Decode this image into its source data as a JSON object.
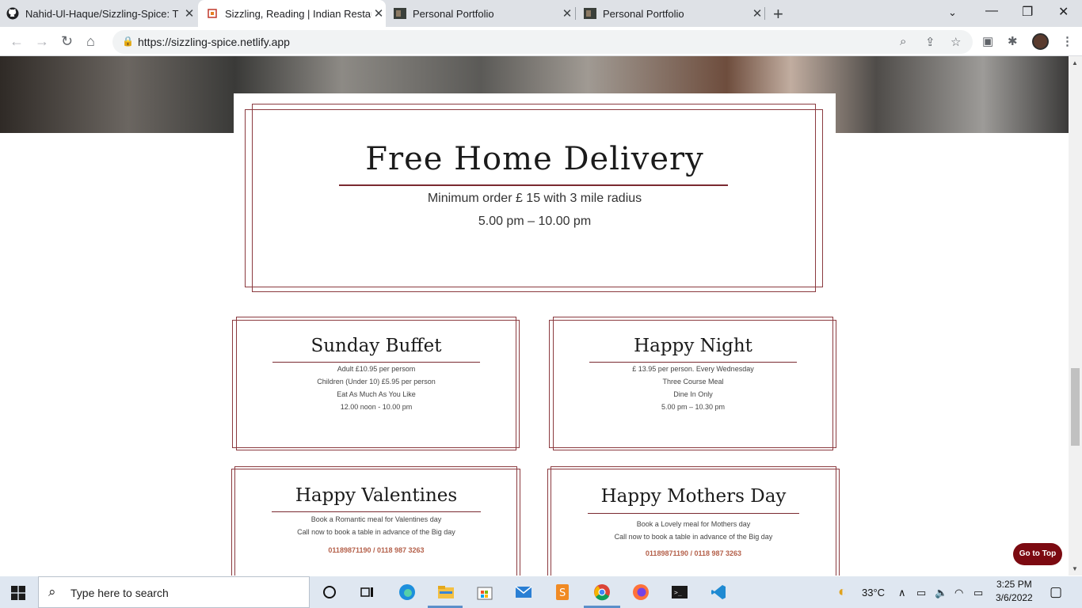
{
  "tabs": [
    {
      "title": "Nahid-Ul-Haque/Sizzling-Spice: T",
      "icon": "github-icon"
    },
    {
      "title": "Sizzling, Reading | Indian Restaur",
      "icon": "restaurant-logo-icon"
    },
    {
      "title": "Personal Portfolio",
      "icon": "portfolio-thumbnail-icon"
    },
    {
      "title": "Personal Portfolio",
      "icon": "portfolio-thumbnail-icon"
    }
  ],
  "address_bar": {
    "url": "https://sizzling-spice.netlify.app"
  },
  "delivery": {
    "title": "Free Home Delivery",
    "line1": "Minimum order £ 15 with 3 mile radius",
    "line2": "5.00 pm – 10.00 pm"
  },
  "offers": [
    {
      "title": "Sunday Buffet",
      "lines": [
        "Adult £10.95 per persom",
        "Children (Under 10) £5.95 per person",
        "Eat As Much As You Like",
        "12.00 noon - 10.00 pm"
      ]
    },
    {
      "title": "Happy Night",
      "lines": [
        "£ 13.95 per person. Every Wednesday",
        "Three Course Meal",
        "Dine In Only",
        "5.00 pm – 10.30 pm"
      ]
    },
    {
      "title": "Happy Valentines",
      "lines": [
        "Book a Romantic meal for Valentines day",
        "Call now to book a table in advance of the Big day"
      ],
      "phone": "01189871190 / 0118 987 3263"
    },
    {
      "title": "Happy Mothers Day",
      "lines": [
        "Book a Lovely meal for Mothers day",
        "Call now to book a table in advance of the Big day"
      ],
      "phone": "01189871190 / 0118 987 3263"
    }
  ],
  "go_top": "Go to Top",
  "taskbar": {
    "search_placeholder": "Type here to search",
    "temperature": "33°C",
    "time": "3:25 PM",
    "date": "3/6/2022"
  },
  "colors": {
    "accent": "#7c0a11",
    "border": "#8b3a3f",
    "phone": "#b4604a"
  }
}
